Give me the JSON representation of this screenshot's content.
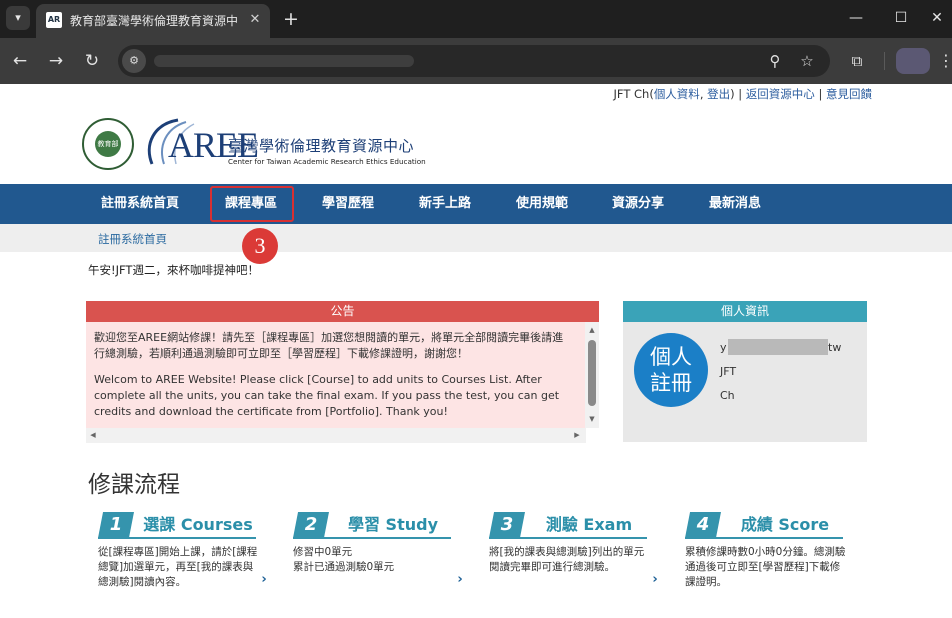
{
  "browser": {
    "tab_title": "教育部臺灣學術倫理教育資源中",
    "favicon_text": "AR"
  },
  "header": {
    "user_links": {
      "user": "JFT Ch(",
      "profile": "個人資料",
      "comma": ", ",
      "logout": "登出",
      "sep1": ") | ",
      "back": "返回資源中心",
      "sep2": " | ",
      "feedback": "意見回饋"
    },
    "logo_word": "AREE",
    "moe_text": "教育部",
    "org_name": "臺灣學術倫理教育資源中心",
    "org_name_en": "Center for Taiwan Academic Research Ethics Education"
  },
  "nav": {
    "items": [
      "註冊系統首頁",
      "課程專區",
      "學習歷程",
      "新手上路",
      "使用規範",
      "資源分享",
      "最新消息"
    ],
    "step_marker": "3"
  },
  "breadcrumb": "註冊系統首頁",
  "greeting": "午安!JFT週二，來杯咖啡提神吧！",
  "announcement": {
    "title": "公告",
    "zh": "歡迎您至AREE網站修課！請先至［課程專區］加選您想閱讀的單元，將單元全部閱讀完畢後請進行總測驗，若順利通過測驗即可立即至［學習歷程］下載修課證明，謝謝您！",
    "en": "Welcom to AREE Website! Please click [Course] to add units to Courses List. After complete all the units, you can take the final exam.  If you pass the test, you can get credits and download the certificate from [Portfolio]. Thank you!"
  },
  "profile": {
    "title": "個人資訊",
    "badge_line1": "個人",
    "badge_line2": "註冊",
    "line1_prefix": "y",
    "line1_suffix": "tw",
    "line2": "JFT",
    "line3": "Ch"
  },
  "flow": {
    "title": "修課流程",
    "steps": [
      {
        "num": "1",
        "label": "選課 Courses",
        "desc": "從[課程專區]開始上課，請於[課程總覽]加選單元，再至[我的課表與總測驗]閱讀內容。"
      },
      {
        "num": "2",
        "label": "學習 Study",
        "desc": "修習中0單元\n累計已通過測驗0單元"
      },
      {
        "num": "3",
        "label": "測驗 Exam",
        "desc": "將[我的課表與總測驗]列出的單元閱讀完畢即可進行總測驗。"
      },
      {
        "num": "4",
        "label": "成績 Score",
        "desc": "累積修課時數0小時0分鐘。總測驗通過後可立即至[學習歷程]下載修課證明。"
      }
    ]
  }
}
